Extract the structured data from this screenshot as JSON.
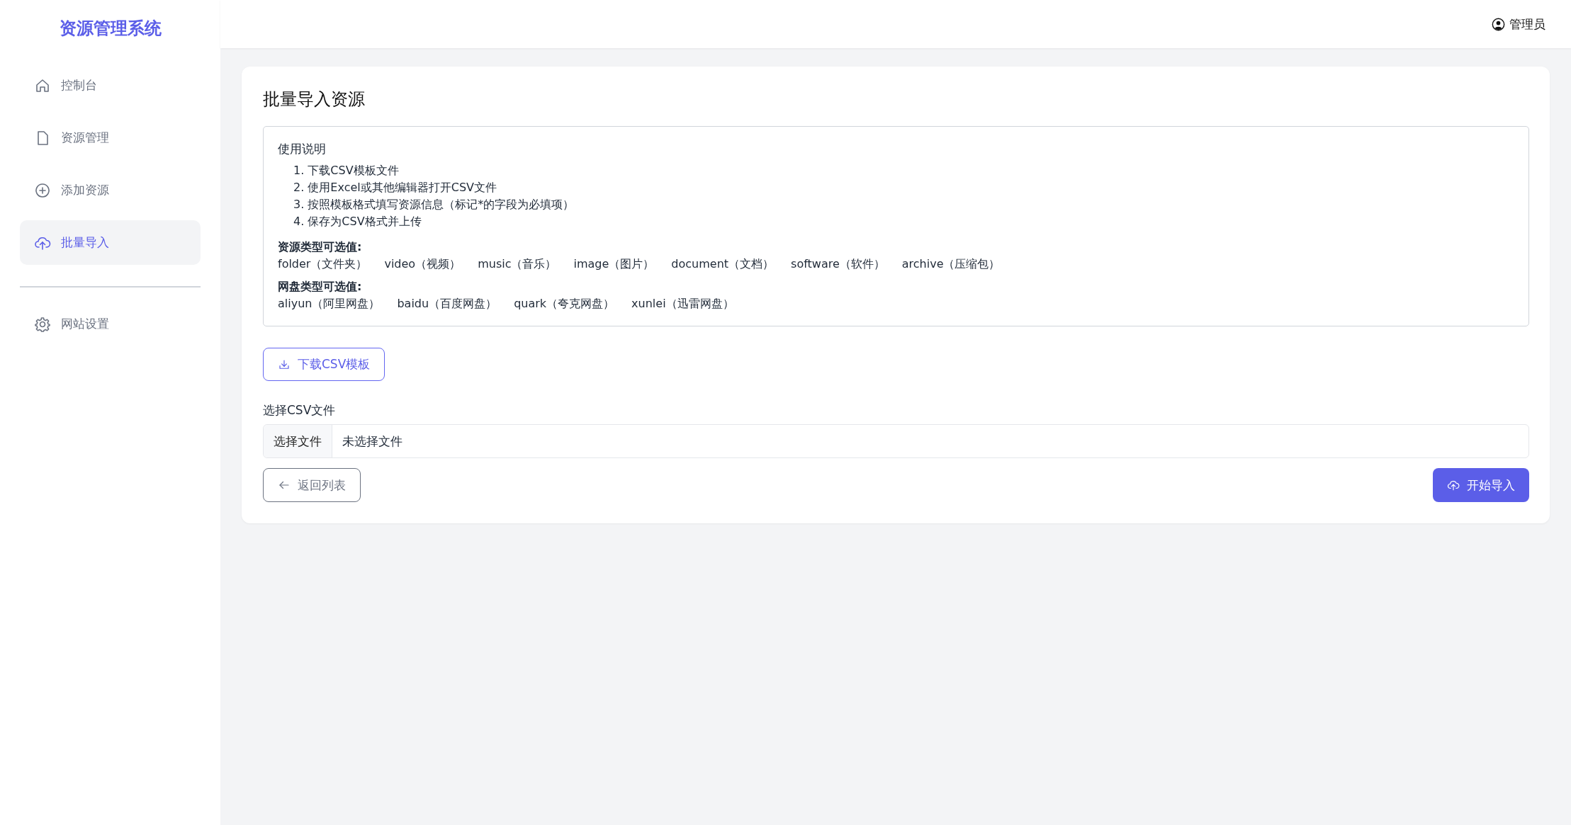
{
  "sidebar": {
    "logo": "资源管理系统",
    "sections": [
      {
        "items": [
          {
            "kind": "home",
            "label": "控制台",
            "selected": false
          },
          {
            "kind": "file",
            "label": "资源管理",
            "selected": false
          },
          {
            "kind": "plus",
            "label": "添加资源",
            "selected": false
          },
          {
            "kind": "upload",
            "label": "批量导入",
            "selected": true
          }
        ]
      },
      {
        "items": [
          {
            "kind": "gear",
            "label": "网站设置",
            "selected": false
          }
        ]
      }
    ]
  },
  "header": {
    "user": "管理员"
  },
  "card": {
    "title": "批量导入资源",
    "instructions": {
      "title": "使用说明",
      "steps": [
        "1. 下载CSV模板文件",
        "2. 使用Excel或其他编辑器打开CSV文件",
        "3. 按照模板格式填写资源信息（标记*的字段为必填项）",
        "4. 保存为CSV格式并上传"
      ],
      "groups": [
        {
          "heading": "资源类型可选值:",
          "options": [
            "folder（文件夹）",
            "video（视频）",
            "music（音乐）",
            "image（图片）",
            "document（文档）",
            "software（软件）",
            "archive（压缩包）"
          ]
        },
        {
          "heading": "网盘类型可选值:",
          "options": [
            "aliyun（阿里网盘）",
            "baidu（百度网盘）",
            "quark（夸克网盘）",
            "xunlei（迅雷网盘）"
          ]
        }
      ]
    },
    "download_button": "下载CSV模板",
    "file_field": {
      "label": "选择CSV文件",
      "button": "选择文件",
      "value": "未选择文件"
    },
    "back_button": "返回列表",
    "submit_button": "开始导入"
  }
}
